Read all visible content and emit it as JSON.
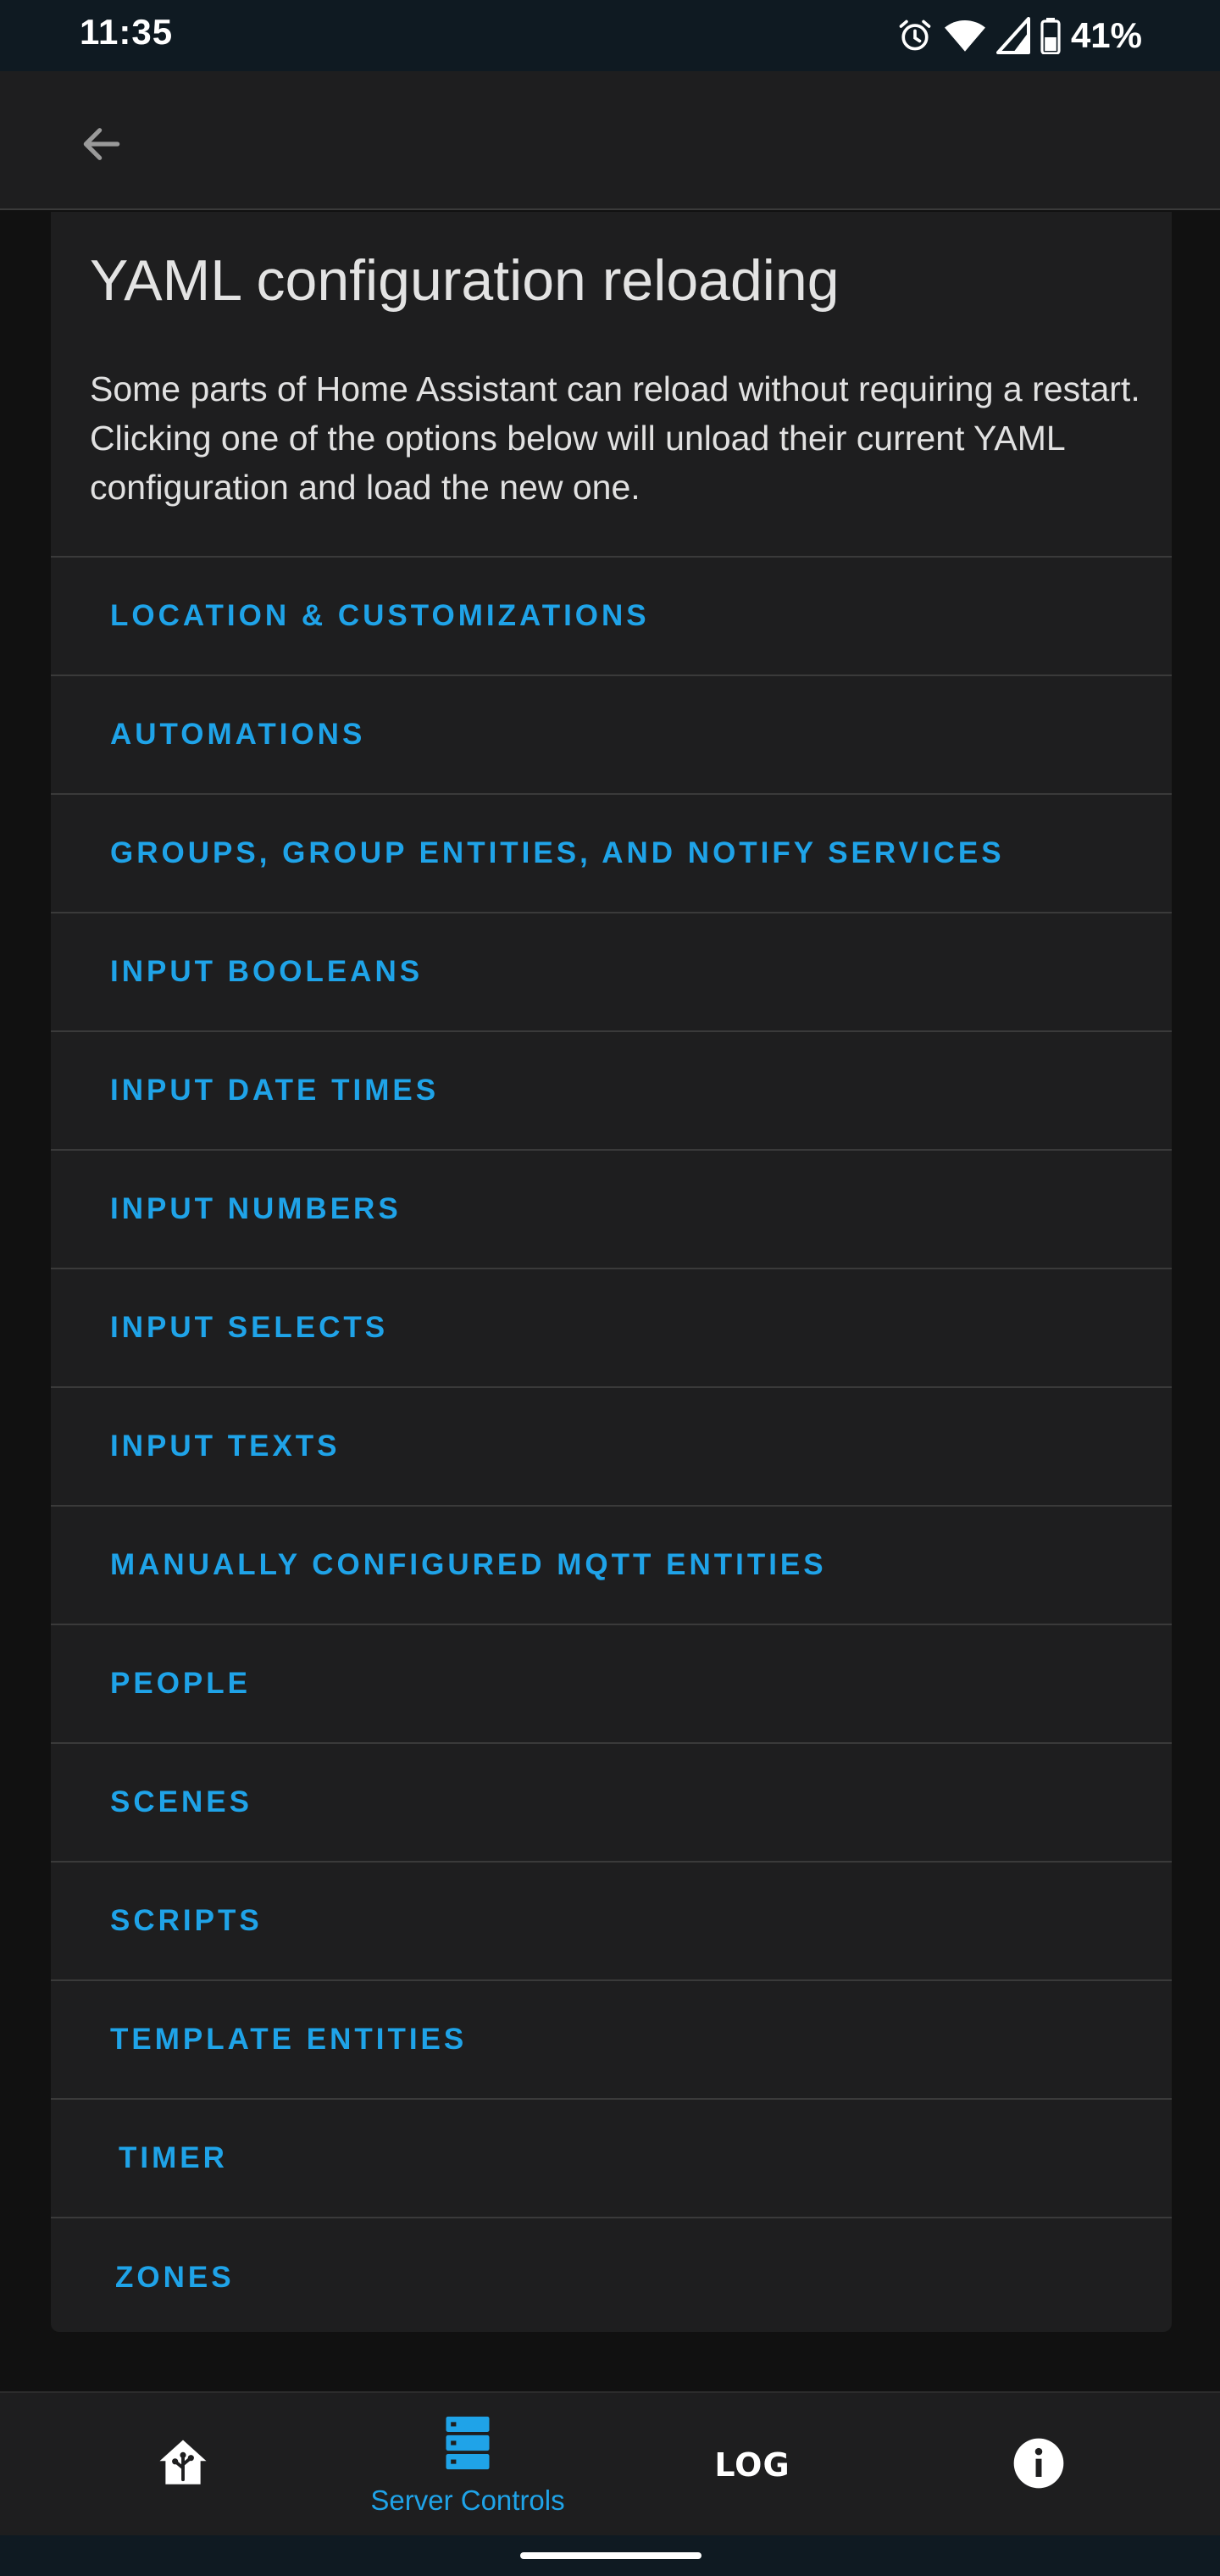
{
  "status_bar": {
    "time": "11:35",
    "battery_percent": "41%",
    "icons": [
      "alarm-icon",
      "wifi-icon",
      "signal-icon",
      "battery-icon"
    ]
  },
  "app_bar": {
    "back_icon": "arrow-left-icon"
  },
  "card": {
    "title": "YAML configuration reloading",
    "description": "Some parts of Home Assistant can reload without requiring a restart. Clicking one of the options below will unload their current YAML configuration and load the new one.",
    "items": [
      {
        "label": "LOCATION & CUSTOMIZATIONS"
      },
      {
        "label": "AUTOMATIONS"
      },
      {
        "label": "GROUPS, GROUP ENTITIES, AND NOTIFY SERVICES"
      },
      {
        "label": "INPUT BOOLEANS"
      },
      {
        "label": "INPUT DATE TIMES"
      },
      {
        "label": "INPUT NUMBERS"
      },
      {
        "label": "INPUT SELECTS"
      },
      {
        "label": "INPUT TEXTS"
      },
      {
        "label": "MANUALLY CONFIGURED MQTT ENTITIES"
      },
      {
        "label": "PEOPLE"
      },
      {
        "label": "SCENES"
      },
      {
        "label": "SCRIPTS"
      },
      {
        "label": "TEMPLATE ENTITIES"
      },
      {
        "label": "TIMER"
      },
      {
        "label": "ZONES"
      }
    ]
  },
  "bottom_nav": {
    "items": [
      {
        "icon": "home-assistant-icon",
        "label": ""
      },
      {
        "icon": "server-icon",
        "label": "Server Controls",
        "active": true
      },
      {
        "icon": "log-icon",
        "label": "LOG"
      },
      {
        "icon": "info-icon",
        "label": ""
      }
    ]
  },
  "colors": {
    "accent": "#1fa3e8",
    "background": "#111111",
    "surface": "#1e1e1f",
    "divider": "#3a3a3a",
    "status_bar": "#0f1a22"
  }
}
